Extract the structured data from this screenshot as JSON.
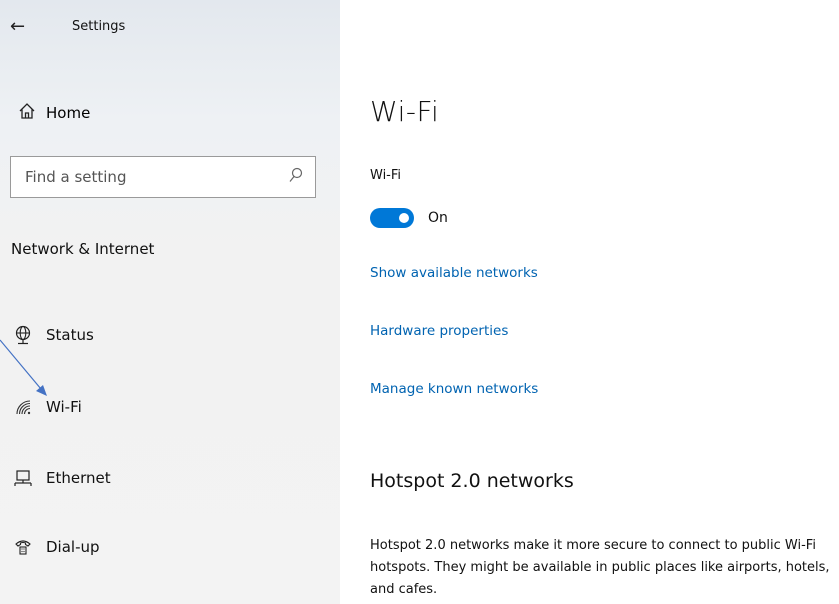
{
  "sidebar": {
    "back_icon": "back-arrow-icon",
    "app_title": "Settings",
    "home_label": "Home",
    "search_placeholder": "Find a setting",
    "section_title": "Network & Internet",
    "items": [
      {
        "label": "Status",
        "icon": "globe-icon"
      },
      {
        "label": "Wi-Fi",
        "icon": "wifi-icon"
      },
      {
        "label": "Ethernet",
        "icon": "ethernet-icon"
      },
      {
        "label": "Dial-up",
        "icon": "dialup-icon"
      }
    ]
  },
  "main": {
    "title": "Wi-Fi",
    "wifi_label": "Wi-Fi",
    "toggle_state": "On",
    "toggle_on": true,
    "links": [
      "Show available networks",
      "Hardware properties",
      "Manage known networks"
    ],
    "hotspot_heading": "Hotspot 2.0 networks",
    "hotspot_description": "Hotspot 2.0 networks make it more secure to connect to public Wi-Fi hotspots. They might be available in public places like airports, hotels, and cafes."
  },
  "colors": {
    "accent": "#0078d7",
    "link": "#0063b1",
    "annotation_arrow": "#4472c4"
  }
}
